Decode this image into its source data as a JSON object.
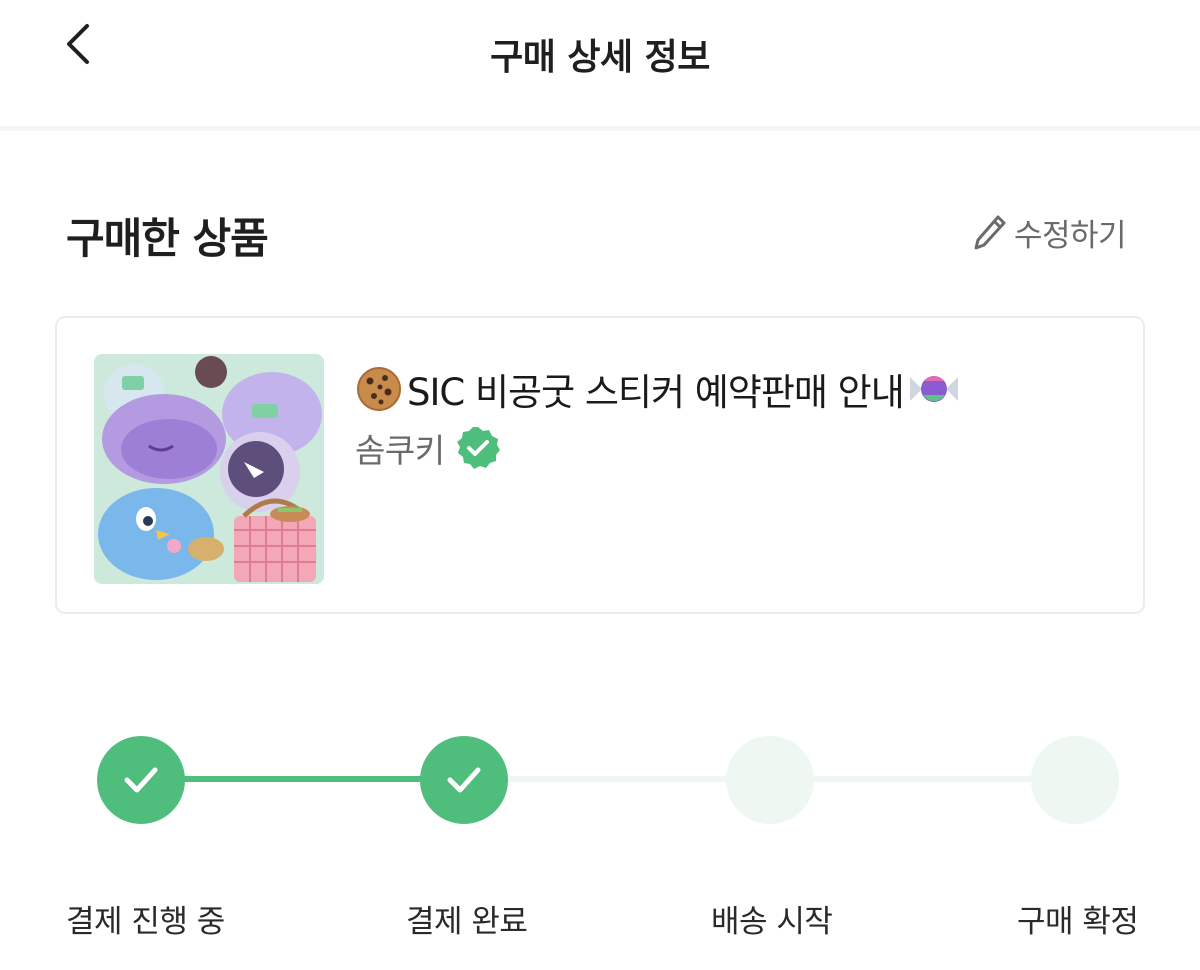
{
  "header": {
    "title": "구매 상세 정보",
    "back_icon": "chevron-left-icon"
  },
  "section": {
    "title": "구매한 상품",
    "edit_label": "수정하기",
    "edit_icon": "pencil-icon"
  },
  "product": {
    "name": "SIC 비공굿 스티커 예약판매 안내",
    "leading_emoji": "cookie",
    "trailing_emoji": "candy",
    "seller": "솜쿠키",
    "seller_verified": true
  },
  "progress": {
    "steps": [
      {
        "label": "결제 진행 중",
        "done": true
      },
      {
        "label": "결제 완료",
        "done": true
      },
      {
        "label": "배송 시작",
        "done": false
      },
      {
        "label": "구매 확정",
        "done": false
      }
    ]
  },
  "colors": {
    "accent": "#4fbd7c",
    "inactive": "#eef7f2",
    "muted_text": "#6a6a6a"
  }
}
